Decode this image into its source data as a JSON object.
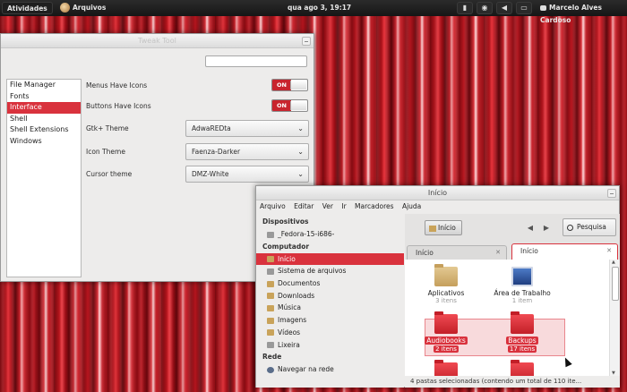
{
  "topbar": {
    "activities": "Atividades",
    "app_menu": "Arquivos",
    "clock": "qua ago 3, 19:17",
    "user": "Marcelo Alves Cardoso"
  },
  "tweak": {
    "title": "Tweak Tool",
    "categories": [
      "File Manager",
      "Fonts",
      "Interface",
      "Shell",
      "Shell Extensions",
      "Windows"
    ],
    "selected_category": "Interface",
    "menus_icons_label": "Menus Have Icons",
    "menus_icons_value": "ON",
    "buttons_icons_label": "Buttons Have Icons",
    "buttons_icons_value": "ON",
    "gtk_label": "Gtk+ Theme",
    "gtk_value": "AdwaREDta",
    "icon_label": "Icon Theme",
    "icon_value": "Faenza-Darker",
    "cursor_label": "Cursor theme",
    "cursor_value": "DMZ-White"
  },
  "nautilus": {
    "title": "Início",
    "menu": [
      "Arquivo",
      "Editar",
      "Ver",
      "Ir",
      "Marcadores",
      "Ajuda"
    ],
    "sidebar": {
      "devices_header": "Dispositivos",
      "devices": [
        "_Fedora-15-i686-"
      ],
      "computer_header": "Computador",
      "computer": [
        "Início",
        "Sistema de arquivos",
        "Documentos",
        "Downloads",
        "Música",
        "Imagens",
        "Vídeos",
        "Lixeira"
      ],
      "network_header": "Rede",
      "network": [
        "Navegar na rede"
      ]
    },
    "breadcrumb": "Início",
    "search_label": "Pesquisa",
    "tabs": [
      "Início",
      "Início"
    ],
    "files": [
      {
        "name": "Aplicativos",
        "info": "3 itens"
      },
      {
        "name": "Área de Trabalho",
        "info": "1 item"
      },
      {
        "name": "Audiobooks",
        "info": "2 itens"
      },
      {
        "name": "Backups",
        "info": "17 itens"
      }
    ],
    "status": "4 pastas selecionadas (contendo um total de 110 ite..."
  },
  "colors": {
    "accent": "#d9323d",
    "panel": "#1c1c1c"
  }
}
